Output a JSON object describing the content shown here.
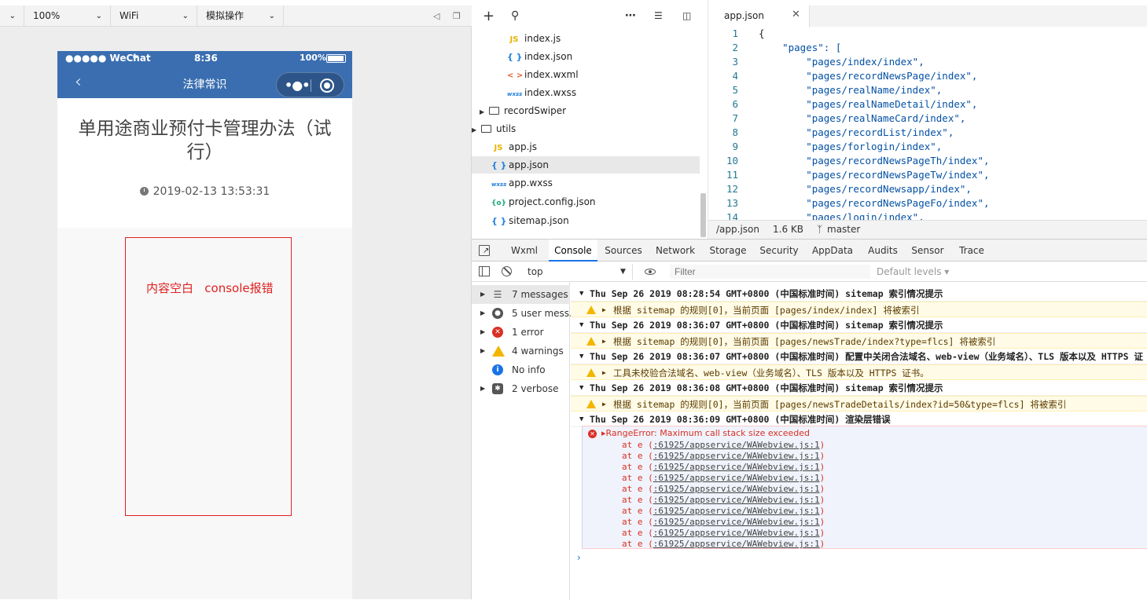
{
  "simulator": {
    "toolbar": {
      "zoom": "100%",
      "network": "WiFi",
      "operate": "模拟操作"
    },
    "phone": {
      "carrier": "●●●●● WeChat",
      "time": "8:36",
      "battery": "100%",
      "nav_title": "法律常识",
      "article_title": "单用途商业预付卡管理办法（试行）",
      "article_date": "2019-02-13 13:53:31"
    },
    "annotation": "内容空白   console报错"
  },
  "file_tree": [
    {
      "label": "index.js",
      "icon": "js-file-icon",
      "badge": "JS"
    },
    {
      "label": "index.json",
      "icon": "json-file-icon",
      "badge": "{ }"
    },
    {
      "label": "index.wxml",
      "icon": "wxml-file-icon",
      "badge": "< >"
    },
    {
      "label": "index.wxss",
      "icon": "wxss-file-icon",
      "badge": "wxss"
    },
    {
      "label": "recordSwiper",
      "icon": "folder-icon",
      "badge": ""
    },
    {
      "label": "utils",
      "icon": "folder-icon",
      "badge": ""
    },
    {
      "label": "app.js",
      "icon": "js-file-icon",
      "badge": "JS"
    },
    {
      "label": "app.json",
      "icon": "json-file-icon",
      "badge": "{ }",
      "selected": true
    },
    {
      "label": "app.wxss",
      "icon": "wxss-file-icon",
      "badge": "wxss"
    },
    {
      "label": "project.config.json",
      "icon": "config-file-icon",
      "badge": "{o}"
    },
    {
      "label": "sitemap.json",
      "icon": "json-file-icon",
      "badge": "{ }"
    }
  ],
  "editor": {
    "tab_label": "app.json",
    "lines": [
      {
        "n": "1",
        "text": "{"
      },
      {
        "n": "2",
        "text": "    \"pages\": ["
      },
      {
        "n": "3",
        "text": "        \"pages/index/index\","
      },
      {
        "n": "4",
        "text": "        \"pages/recordNewsPage/index\","
      },
      {
        "n": "5",
        "text": "        \"pages/realName/index\","
      },
      {
        "n": "6",
        "text": "        \"pages/realNameDetail/index\","
      },
      {
        "n": "7",
        "text": "        \"pages/realNameCard/index\","
      },
      {
        "n": "8",
        "text": "        \"pages/recordList/index\","
      },
      {
        "n": "9",
        "text": "        \"pages/forlogin/index\","
      },
      {
        "n": "10",
        "text": "        \"pages/recordNewsPageTh/index\","
      },
      {
        "n": "11",
        "text": "        \"pages/recordNewsPageTw/index\","
      },
      {
        "n": "12",
        "text": "        \"pages/recordNewsapp/index\","
      },
      {
        "n": "13",
        "text": "        \"pages/recordNewsPageFo/index\","
      },
      {
        "n": "14",
        "text": "        \"pages/login/index\","
      }
    ],
    "status": {
      "path": "/app.json",
      "size": "1.6 KB",
      "branch": "master"
    }
  },
  "devtools": {
    "tabs": [
      "Wxml",
      "Console",
      "Sources",
      "Network",
      "Storage",
      "Security",
      "AppData",
      "Audits",
      "Sensor",
      "Trace"
    ],
    "active_tab": "Console",
    "context": "top",
    "filter_placeholder": "Filter",
    "levels": "Default levels ▾",
    "sidebar": [
      {
        "label": "7 messages",
        "icon": "list-icon"
      },
      {
        "label": "5 user mess...",
        "icon": "user-icon"
      },
      {
        "label": "1 error",
        "icon": "error-icon"
      },
      {
        "label": "4 warnings",
        "icon": "warning-icon"
      },
      {
        "label": "No info",
        "icon": "info-icon"
      },
      {
        "label": "2 verbose",
        "icon": "bug-icon"
      }
    ],
    "logs": [
      {
        "type": "group",
        "text": "Thu Sep 26 2019 08:28:54 GMT+0800 (中国标准时间) sitemap 索引情况提示"
      },
      {
        "type": "warn",
        "text": "根据 sitemap 的规则[0]，当前页面 [pages/index/index] 将被索引"
      },
      {
        "type": "group",
        "text": "Thu Sep 26 2019 08:36:07 GMT+0800 (中国标准时间) sitemap 索引情况提示"
      },
      {
        "type": "warn",
        "text": "根据 sitemap 的规则[0]，当前页面 [pages/newsTrade/index?type=flcs] 将被索引"
      },
      {
        "type": "group",
        "text": "Thu Sep 26 2019 08:36:07 GMT+0800 (中国标准时间) 配置中关闭合法域名、web-view（业务域名）、TLS 版本以及 HTTPS 证"
      },
      {
        "type": "warn",
        "text": "工具未校验合法域名、web-view（业务域名）、TLS 版本以及 HTTPS 证书。"
      },
      {
        "type": "group",
        "text": "Thu Sep 26 2019 08:36:08 GMT+0800 (中国标准时间) sitemap 索引情况提示"
      },
      {
        "type": "warn",
        "text": "根据 sitemap 的规则[0]，当前页面 [pages/newsTradeDetails/index?id=50&type=flcs] 将被索引"
      },
      {
        "type": "group",
        "text": "Thu Sep 26 2019 08:36:09 GMT+0800 (中国标准时间) 渲染层错误"
      }
    ],
    "error": {
      "message": "RangeError: Maximum call stack size exceeded",
      "stack_prefix": "at e (",
      "stack_link": ":61925/appservice/WAWebview.js:1",
      "stack_suffix": ")",
      "stack_count": 10
    }
  }
}
